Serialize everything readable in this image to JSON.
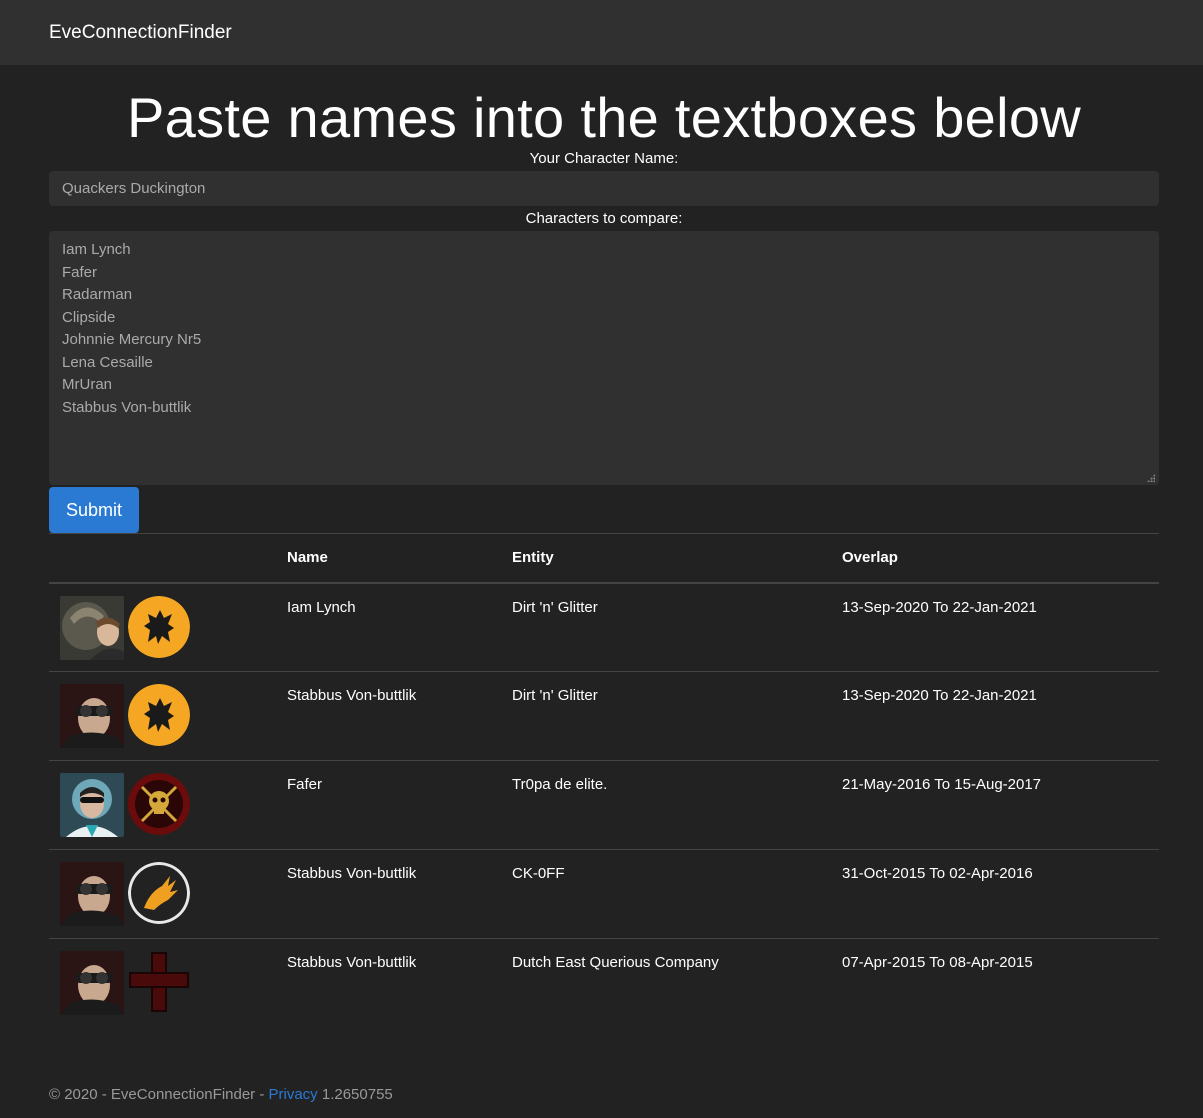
{
  "nav": {
    "brand": "EveConnectionFinder"
  },
  "main": {
    "heading": "Paste names into the textboxes below",
    "character_label": "Your Character Name:",
    "character_value": "Quackers Duckington",
    "compare_label": "Characters to compare:",
    "compare_lines": [
      "Iam Lynch",
      "Fafer",
      "Radarman",
      "Clipside",
      "Johnnie Mercury Nr5",
      "Lena Cesaille",
      "MrUran",
      "Stabbus Von-buttlik"
    ],
    "submit_label": "Submit"
  },
  "table": {
    "headers": {
      "images": "",
      "name": "Name",
      "entity": "Entity",
      "overlap": "Overlap"
    },
    "rows": [
      {
        "name": "Iam Lynch",
        "entity": "Dirt 'n' Glitter",
        "overlap": "13-Sep-2020 To 22-Jan-2021",
        "portrait_icon": "character-portrait-icon",
        "logo_icon": "lion-corp-logo-icon"
      },
      {
        "name": "Stabbus Von-buttlik",
        "entity": "Dirt 'n' Glitter",
        "overlap": "13-Sep-2020 To 22-Jan-2021",
        "portrait_icon": "character-portrait-icon",
        "logo_icon": "lion-corp-logo-icon"
      },
      {
        "name": "Fafer",
        "entity": "Tr0pa de elite.",
        "overlap": "21-May-2016 To 15-Aug-2017",
        "portrait_icon": "character-portrait-icon",
        "logo_icon": "skull-corp-logo-icon"
      },
      {
        "name": "Stabbus Von-buttlik",
        "entity": "CK-0FF",
        "overlap": "31-Oct-2015 To 02-Apr-2016",
        "portrait_icon": "character-portrait-icon",
        "logo_icon": "claw-corp-logo-icon"
      },
      {
        "name": "Stabbus Von-buttlik",
        "entity": "Dutch East Querious Company",
        "overlap": "07-Apr-2015 To 08-Apr-2015",
        "portrait_icon": "character-portrait-icon",
        "logo_icon": "red-cross-corp-logo-icon"
      }
    ]
  },
  "footer": {
    "copyright": "© 2020 - EveConnectionFinder - ",
    "privacy_link": "Privacy",
    "version": " 1.2650755"
  },
  "colors": {
    "background": "#222222",
    "navbar": "#303030",
    "input_bg": "#303030",
    "accent": "#2a7ad3",
    "logo_orange": "#f5a623"
  }
}
